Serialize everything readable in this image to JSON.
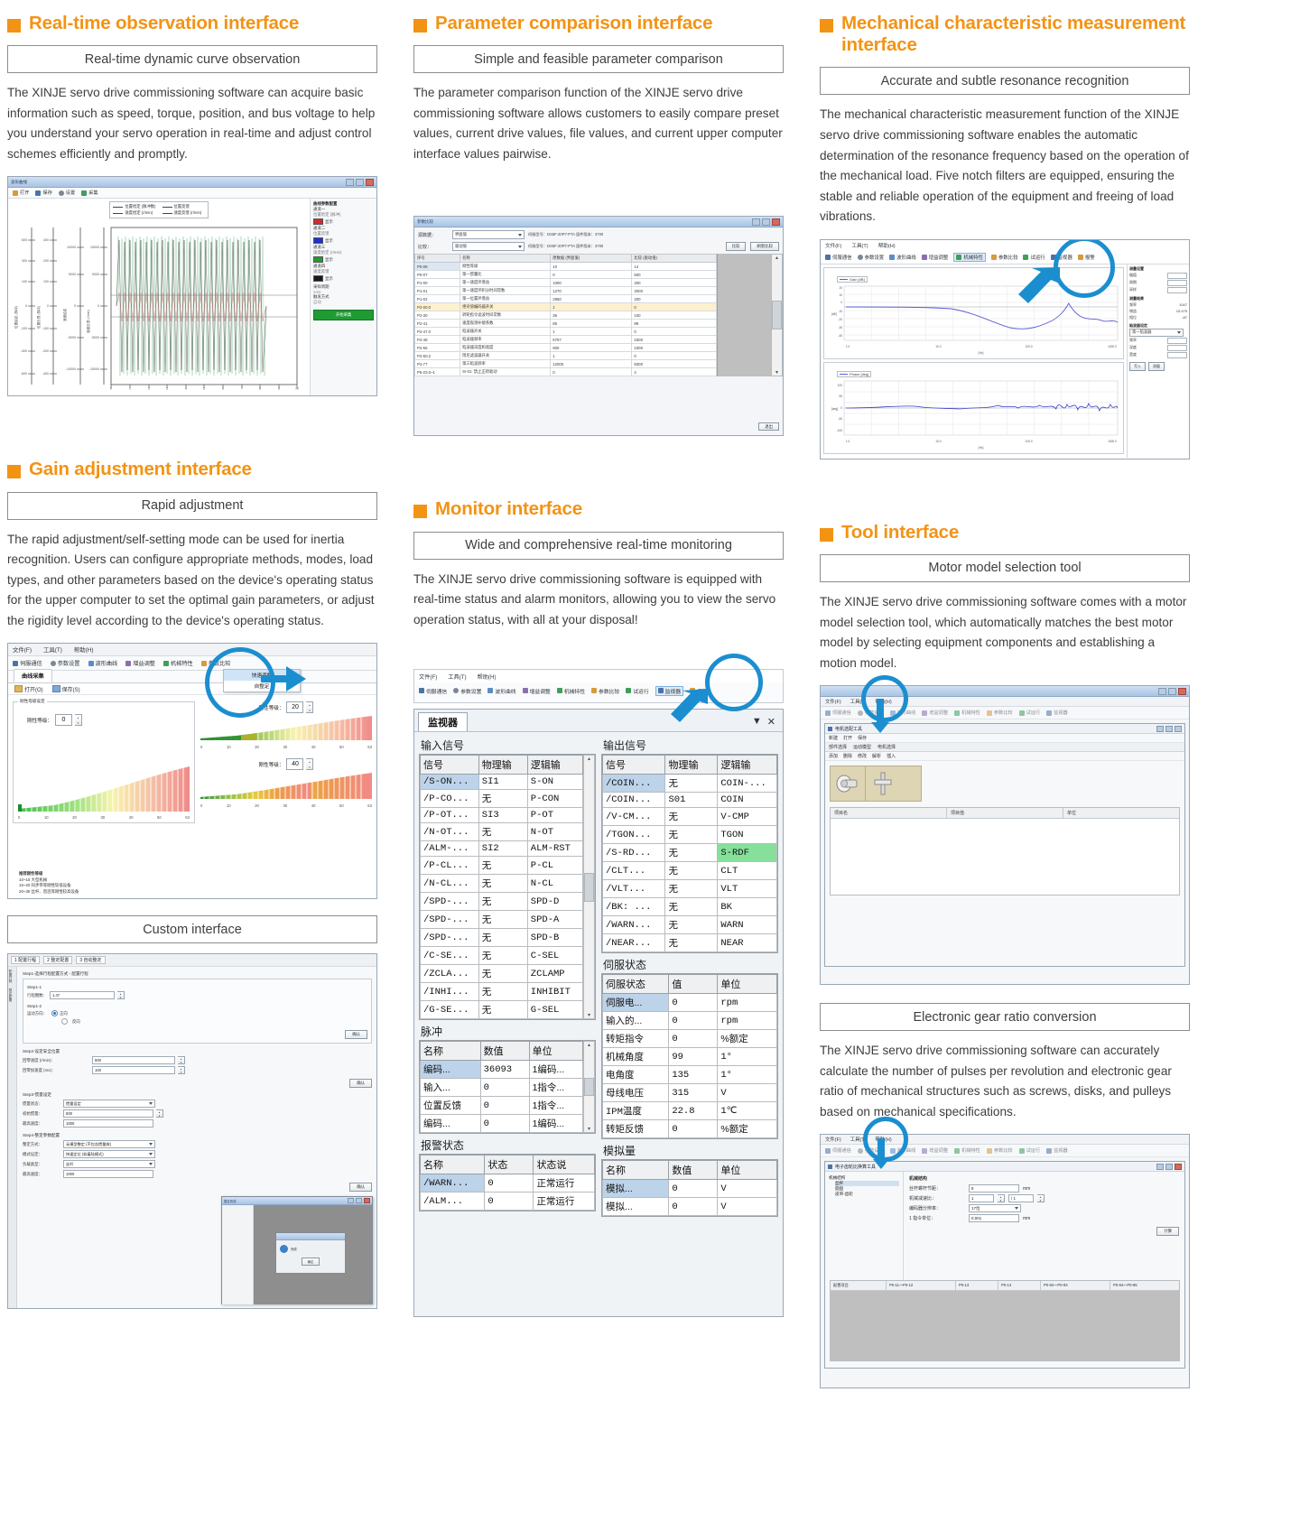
{
  "theme": {
    "accent": "#f39314",
    "annotation": "#1b8ed0",
    "text": "#3d3d3d"
  },
  "sections": [
    {
      "title": "Real-time observation interface",
      "subtitle": "Real-time dynamic curve observation",
      "body": "The XINJE servo drive commissioning software can acquire basic information such as speed, torque, position, and bus voltage to help you understand your servo operation in real-time and adjust control schemes efficiently and promptly."
    },
    {
      "title": "Parameter comparison interface",
      "subtitle": "Simple and feasible parameter comparison",
      "body": "The parameter comparison function of the XINJE servo drive commissioning software allows customers to easily compare preset values, current drive values, file values, and current upper computer interface values pairwise."
    },
    {
      "title": "Mechanical characteristic measurement interface",
      "subtitle": "Accurate and subtle resonance recognition",
      "body": "The mechanical characteristic measurement function of the XINJE servo drive commissioning software enables the automatic determination of the resonance frequency based on the operation of the mechanical load. Five notch filters are equipped, ensuring the stable and reliable operation of the equipment and freeing of load vibrations."
    },
    {
      "title": "Gain adjustment interface",
      "subtitle": "Rapid adjustment",
      "body": "The rapid adjustment/self-setting mode can be used for inertia recognition. Users can configure appropriate methods, modes, load types, and other parameters based on the device's operating status for the upper computer to set the optimal gain parameters, or adjust the rigidity level according to the device's operating status."
    },
    {
      "title": "Monitor interface",
      "subtitle": "Wide and comprehensive real-time monitoring",
      "body": "The XINJE servo drive commissioning software is equipped with real-time status and alarm monitors, allowing you to view the servo operation status, with all at your disposal!"
    },
    {
      "title": "Tool interface",
      "subtitle": "Motor model selection tool",
      "body": "The XINJE servo drive commissioning software comes with a motor model selection tool, which automatically matches the best motor model by selecting equipment components and establishing a motion model."
    }
  ],
  "extra_blocks": {
    "custom_interface": {
      "subtitle": "Custom interface"
    },
    "gear_ratio": {
      "subtitle": "Electronic gear ratio conversion",
      "body": "The XINJE servo drive commissioning software can accurately calculate the number of pulses per revolution and electronic gear ratio of mechanical structures such as screws, disks, and pulleys based on mechanical specifications."
    }
  },
  "app_chrome": {
    "menus": [
      "文件(F)",
      "工具(T)",
      "帮助(H)"
    ],
    "toolbar": [
      "伺服通信",
      "参数设置",
      "波形曲线",
      "增益调整",
      "机械特性",
      "参数比较",
      "试运行",
      "监视器",
      "报警"
    ]
  },
  "card1_curve": {
    "window_title": "波形曲线",
    "toolbar": [
      "打开",
      "保存",
      "设置",
      "采集"
    ],
    "legend": [
      "位置给定 (脉冲数)",
      "位置反馈",
      "速度给定 (r/min)",
      "速度反馈 (r/min)"
    ],
    "side_title": "曲线参数配置",
    "channels": [
      {
        "label": "通道一",
        "sub": "位置给定 (脉冲)",
        "color": "#d42a2a",
        "btn": "显示"
      },
      {
        "label": "通道二",
        "sub": "位置反馈",
        "color": "#1f2fd0",
        "btn": "显示"
      },
      {
        "label": "通道三",
        "sub": "速度给定 (r/min)",
        "color": "#1f9b33",
        "btn": "显示"
      },
      {
        "label": "通道四",
        "sub": "速度反馈",
        "color": "#1a1a1a",
        "btn": "显示"
      }
    ],
    "fields": [
      {
        "label": "采样周期",
        "value": "1ms"
      },
      {
        "label": "触发方式",
        "value": "自动"
      }
    ],
    "action": "开始采集",
    "y_axes": [
      [
        "600",
        "300",
        "100",
        "0",
        "-100",
        "-300",
        "-600"
      ],
      [
        "400",
        "200",
        "100",
        "0",
        "-100",
        "-200",
        "-400"
      ],
      [
        "10000",
        "5000",
        "0",
        "-5000",
        "-10000"
      ],
      [
        "15000",
        "5000",
        "0",
        "-5000",
        "-15000"
      ]
    ],
    "x_ticks": [
      "0",
      "1",
      "2",
      "3",
      "4",
      "5",
      "6",
      "7",
      "8",
      "9",
      "10"
    ],
    "x_label": "s"
  },
  "card2_compare": {
    "window_title": "参数比较",
    "source_label": "源数据：",
    "compare_label": "比较：",
    "source_value": "界面值",
    "compare_value": "驱动值",
    "source_meta": "伺服型号：DS5F-20P7-PTA  固件版本：3700",
    "compare_meta": "伺服型号：DS5F-20P7-PTA  固件版本：3700",
    "btn_compare": "比较",
    "btn_export": "刷新比较",
    "btn_close": "退出",
    "columns": [
      "序号",
      "名称",
      "原数据 (界面值)",
      "比较 (驱动值)"
    ],
    "rows": [
      {
        "no": "P0-08",
        "name": "刚性等级",
        "a": "10",
        "b": "14"
      },
      {
        "no": "P0-07",
        "name": "第一惯量比",
        "a": "0",
        "b": "500"
      },
      {
        "no": "P1-00",
        "name": "第一速度环增益",
        "a": "1000",
        "b": "200"
      },
      {
        "no": "P1-01",
        "name": "第一速度环积分时间常数",
        "a": "1270",
        "b": "2000"
      },
      {
        "no": "P1-02",
        "name": "第一位置环增益",
        "a": "2950",
        "b": "200"
      },
      {
        "no": "P2-00.0",
        "name": "绝对值编码器开关",
        "a": "1",
        "b": "0",
        "sel": true
      },
      {
        "no": "P2-30",
        "name": "转矩指令滤波时间常数",
        "a": "36",
        "b": "100"
      },
      {
        "no": "P2-41",
        "name": "速度观测补偿系数",
        "a": "85",
        "b": "99"
      },
      {
        "no": "P2-47.0",
        "name": "陷波器开关",
        "a": "1",
        "b": "0"
      },
      {
        "no": "P2-48",
        "name": "陷波器频率",
        "a": "5757",
        "b": "1500"
      },
      {
        "no": "P2-55",
        "name": "陷波器深度和宽度",
        "a": "900",
        "b": "1000"
      },
      {
        "no": "P2-60.2",
        "name": "阻尼滤波器开关",
        "a": "1",
        "b": "0"
      },
      {
        "no": "P2-77",
        "name": "第三陷波频率",
        "a": "12000",
        "b": "5000"
      },
      {
        "no": "P5-23.0~1",
        "name": "SI-01: 禁止正转驱动",
        "a": "0",
        "b": "4"
      }
    ]
  },
  "card3_bode": {
    "charts": [
      {
        "legend": "Gain [dB]",
        "y_ticks": [
          "20",
          "10",
          "0",
          "-10",
          "-20",
          "-30",
          "-40"
        ],
        "y_label": "[dB]",
        "x_ticks": [
          "1.0",
          "10.0",
          "100.0",
          "1000.0"
        ],
        "x_label": "[Hz]"
      },
      {
        "legend": "Phase [deg]",
        "y_ticks": [
          "100",
          "50",
          "0",
          "-50",
          "-100"
        ],
        "y_label": "[deg]",
        "x_ticks": [
          "1.0",
          "10.0",
          "100.0",
          "1000.0"
        ],
        "x_label": "[Hz]"
      }
    ],
    "side_panel": {
      "title": "测量设置",
      "rows": [
        {
          "label": "幅值",
          "value": "50"
        },
        {
          "label": "周期",
          "value": "10"
        },
        {
          "label": "采样",
          "value": "0.125"
        }
      ],
      "result_title": "测量结果",
      "results": [
        {
          "label": "频率",
          "value": "1047"
        },
        {
          "label": "增益",
          "value": "15.475"
        },
        {
          "label": "相位",
          "value": "-87"
        }
      ],
      "filter_title": "陷波器设定",
      "filter_select": "第一陷波器",
      "filter_rows": [
        {
          "label": "频率",
          "value": "5000"
        },
        {
          "label": "深度",
          "value": "0"
        },
        {
          "label": "宽度",
          "value": "2"
        }
      ],
      "buttons": [
        "写入",
        "测量"
      ]
    }
  },
  "card4_gain": {
    "dropdown": {
      "items": [
        "快速调整",
        "自整定"
      ],
      "highlight": 0
    },
    "tab": "曲线采集",
    "file_actions": [
      "打开(O)",
      "保存(S)"
    ],
    "group_title": "刚性等级设定",
    "panels": [
      {
        "label": "刚性等级：",
        "value": "0"
      },
      {
        "label": "刚性等级：",
        "value": "20"
      },
      {
        "label": "刚性等级：",
        "value": "40"
      }
    ],
    "scale_ticks": [
      "0",
      "10",
      "20",
      "30",
      "40",
      "50",
      "63"
    ],
    "mech_title": "推荐刚性等级",
    "mech_rows": [
      "10~15    大型机械",
      "15~20    同步带等刚性较低设备",
      "20~30    丝杆、直连等刚性较高设备"
    ]
  },
  "card4b_custom": {
    "tabs": [
      "1 配置行程",
      "2 整定配置",
      "3 自动整定"
    ],
    "step1_title": "Step1-选择行程配置方式 - 配置行程",
    "step1_label": "Step1-1",
    "step1_field_label": "行程圈数：",
    "step1_field_value": "1.47",
    "step12_label": "Step1-2",
    "dir_label": "运动方向：",
    "dir_options": [
      "正向",
      "反向"
    ],
    "dir_selected": 0,
    "confirm": "确认",
    "step2_title": "Step2-设定安全位置",
    "step2_rows": [
      {
        "label": "回零速度 (r/min)：",
        "value": "500"
      },
      {
        "label": "回零加速度 (ms)：",
        "value": "100"
      }
    ],
    "step3_title": "Step3-惯量设定",
    "step3_rows": [
      {
        "label": "惯量状态：",
        "value": "惯量设定",
        "combo": true
      },
      {
        "label": "初始惯量：",
        "value": "500"
      },
      {
        "label": "最高速度：",
        "value": "1000"
      }
    ],
    "step4_title": "Step4-整定参数配置",
    "step4_rows": [
      {
        "label": "整定方式：",
        "value": "无模型整定 (不包含惯量辨)",
        "combo": true
      },
      {
        "label": "模式设定：",
        "value": "快速定位 (软着陆模式)",
        "combo": true
      },
      {
        "label": "负载类型：",
        "value": "丝杆",
        "combo": true
      },
      {
        "label": "最高速度：",
        "value": "1000"
      }
    ],
    "dialog": {
      "title": "整定完成",
      "btn": "确定"
    }
  },
  "card5_monitor": {
    "tab": "监视器",
    "controls": [
      "▼",
      "✕"
    ],
    "input_group": "输入信号",
    "output_group": "输出信号",
    "signal_columns": [
      "信号",
      "物理输",
      "逻辑输"
    ],
    "input_rows": [
      {
        "sig": "/S-ON...",
        "phy": "SI1",
        "log": "S-ON",
        "sel": true
      },
      {
        "sig": "/P-CO...",
        "phy": "无",
        "log": "P-CON"
      },
      {
        "sig": "/P-OT...",
        "phy": "SI3",
        "log": "P-OT"
      },
      {
        "sig": "/N-OT...",
        "phy": "无",
        "log": "N-OT"
      },
      {
        "sig": "/ALM-...",
        "phy": "SI2",
        "log": "ALM-RST"
      },
      {
        "sig": "/P-CL...",
        "phy": "无",
        "log": "P-CL"
      },
      {
        "sig": "/N-CL...",
        "phy": "无",
        "log": "N-CL"
      },
      {
        "sig": "/SPD-...",
        "phy": "无",
        "log": "SPD-D"
      },
      {
        "sig": "/SPD-...",
        "phy": "无",
        "log": "SPD-A"
      },
      {
        "sig": "/SPD-...",
        "phy": "无",
        "log": "SPD-B"
      },
      {
        "sig": "/C-SE...",
        "phy": "无",
        "log": "C-SEL"
      },
      {
        "sig": "/ZCLA...",
        "phy": "无",
        "log": "ZCLAMP"
      },
      {
        "sig": "/INHI...",
        "phy": "无",
        "log": "INHIBIT"
      },
      {
        "sig": "/G-SE...",
        "phy": "无",
        "log": "G-SEL"
      }
    ],
    "output_rows": [
      {
        "sig": "/COIN...",
        "phy": "无",
        "log": "COIN-...",
        "sel": true
      },
      {
        "sig": "/COIN...",
        "phy": "S01",
        "log": "COIN"
      },
      {
        "sig": "/V-CM...",
        "phy": "无",
        "log": "V-CMP"
      },
      {
        "sig": "/TGON...",
        "phy": "无",
        "log": "TGON"
      },
      {
        "sig": "/S-RD...",
        "phy": "无",
        "log": "S-RDF",
        "green": true
      },
      {
        "sig": "/CLT...",
        "phy": "无",
        "log": "CLT"
      },
      {
        "sig": "/VLT...",
        "phy": "无",
        "log": "VLT"
      },
      {
        "sig": "/BK: ...",
        "phy": "无",
        "log": "BK"
      },
      {
        "sig": "/WARN...",
        "phy": "无",
        "log": "WARN"
      },
      {
        "sig": "/NEAR...",
        "phy": "无",
        "log": "NEAR"
      }
    ],
    "pulse_group": "脉冲",
    "pulse_columns": [
      "名称",
      "数值",
      "单位"
    ],
    "pulse_rows": [
      {
        "name": "编码...",
        "val": "36093",
        "unit": "1编码...",
        "sel": true
      },
      {
        "name": "输入...",
        "val": "0",
        "unit": "1指令..."
      },
      {
        "name": "位置反馈",
        "val": "0",
        "unit": "1指令..."
      },
      {
        "name": "编码...",
        "val": "0",
        "unit": "1编码..."
      }
    ],
    "servo_group": "伺服状态",
    "servo_columns": [
      "伺服状态",
      "值",
      "单位"
    ],
    "servo_rows": [
      {
        "name": "伺服电...",
        "val": "0",
        "unit": "rpm",
        "sel": true
      },
      {
        "name": "输入的...",
        "val": "0",
        "unit": "rpm"
      },
      {
        "name": "转矩指令",
        "val": "0",
        "unit": "%额定"
      },
      {
        "name": "机械角度",
        "val": "99",
        "unit": "1°"
      },
      {
        "name": "电角度",
        "val": "135",
        "unit": "1°"
      },
      {
        "name": "母线电压",
        "val": "315",
        "unit": "V"
      },
      {
        "name": "IPM温度",
        "val": "22.8",
        "unit": "1℃"
      },
      {
        "name": "转矩反馈",
        "val": "0",
        "unit": "%额定"
      }
    ],
    "alarm_group": "报警状态",
    "alarm_columns": [
      "名称",
      "状态",
      "状态说"
    ],
    "alarm_rows": [
      {
        "name": "/WARN...",
        "st": "0",
        "desc": "正常运行",
        "sel": true
      },
      {
        "name": "/ALM...",
        "st": "0",
        "desc": "正常运行"
      }
    ],
    "analog_group": "模拟量",
    "analog_columns": [
      "名称",
      "数值",
      "单位"
    ],
    "analog_rows": [
      {
        "name": "模拟...",
        "val": "0",
        "unit": "V",
        "sel": true
      },
      {
        "name": "模拟...",
        "val": "0",
        "unit": "V"
      }
    ]
  },
  "card6_tool": {
    "inner_title": "电机选配工具",
    "menu": [
      "新建",
      "打开",
      "保存"
    ],
    "tabs": [
      "部件选择",
      "运动模型",
      "电机选择"
    ],
    "actions": [
      "添加",
      "删除",
      "修改",
      "解析",
      "插入"
    ],
    "columns": [
      "项目名",
      "项目值",
      "单位"
    ],
    "icons": [
      "motor-icon",
      "shaft-icon"
    ]
  },
  "card6b_gear": {
    "inner_title": "电子齿轮比换算工具",
    "tree": [
      "机械结构",
      "丝杆",
      "圆盘",
      "皮带-齿轮"
    ],
    "group_title": "机械结构",
    "rows": [
      {
        "label": "丝杆螺杆节距：",
        "value": "8",
        "unit": "mm"
      },
      {
        "label": "机械减速比：",
        "value": "1",
        "value2": "/ 1",
        "unit": ""
      },
      {
        "label": "编码器分辨率：",
        "value": "17位",
        "combo": true
      },
      {
        "label": "1 指令单位：",
        "value": "0.001",
        "unit": "mm"
      }
    ],
    "btn": "计算",
    "result_cols": [
      "配置项目",
      "P0-11～P0-12",
      "P0-13",
      "P0-14",
      "P0-92～P0-93",
      "P0-94～P0-95"
    ]
  }
}
